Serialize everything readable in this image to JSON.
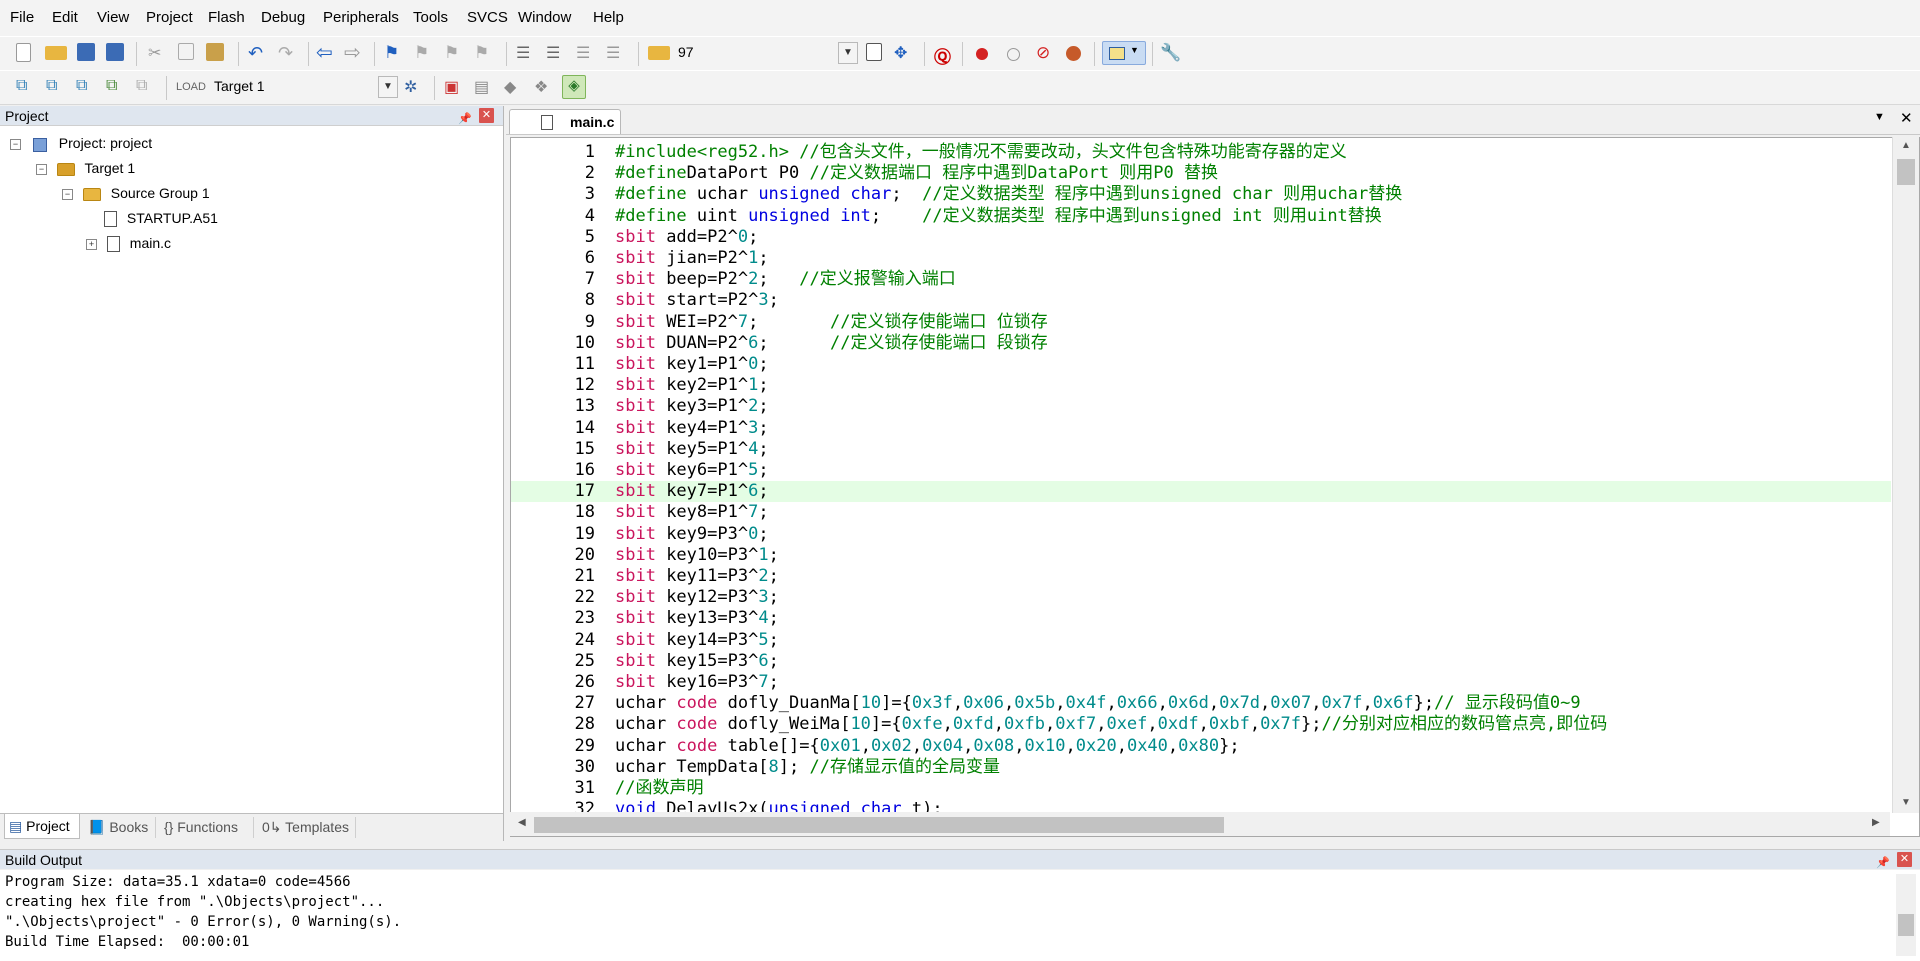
{
  "menu": [
    "File",
    "Edit",
    "View",
    "Project",
    "Flash",
    "Debug",
    "Peripherals",
    "Tools",
    "SVCS",
    "Window",
    "Help"
  ],
  "toolbar": {
    "find_value": "97",
    "target_value": "Target 1"
  },
  "project_panel": {
    "title": "Project",
    "tree": {
      "project": "Project: project",
      "target": "Target 1",
      "group": "Source Group 1",
      "files": [
        "STARTUP.A51",
        "main.c"
      ]
    },
    "tabs": [
      "Project",
      "Books",
      "Functions",
      "Templates"
    ]
  },
  "editor": {
    "tab_label": "main.c",
    "current_line": 17,
    "lines": [
      {
        "n": "1",
        "t": [
          [
            "pp",
            "#include<reg52.h> "
          ],
          [
            "cm",
            "//包含头文件，一般情况不需要改动，头文件包含特殊功能寄存器的定义"
          ]
        ]
      },
      {
        "n": "2",
        "t": [
          [
            "pp",
            "#define"
          ],
          [
            "",
            "DataPort P0 "
          ],
          [
            "cm",
            "//定义数据端口 程序中遇到DataPort 则用P0 替换"
          ]
        ]
      },
      {
        "n": "3",
        "t": [
          [
            "pp",
            "#define"
          ],
          [
            "",
            " uchar "
          ],
          [
            "ty",
            "unsigned char"
          ],
          [
            "",
            ";  "
          ],
          [
            "cm",
            "//定义数据类型 程序中遇到unsigned char 则用uchar替换"
          ]
        ]
      },
      {
        "n": "4",
        "t": [
          [
            "pp",
            "#define"
          ],
          [
            "",
            " uint "
          ],
          [
            "ty",
            "unsigned int"
          ],
          [
            "",
            ";    "
          ],
          [
            "cm",
            "//定义数据类型 程序中遇到unsigned int 则用uint替换"
          ]
        ]
      },
      {
        "n": "5",
        "t": [
          [
            "kw",
            "sbit"
          ],
          [
            "",
            " add=P2^"
          ],
          [
            "num",
            "0"
          ],
          [
            "",
            ";"
          ]
        ]
      },
      {
        "n": "6",
        "t": [
          [
            "kw",
            "sbit"
          ],
          [
            "",
            " jian=P2^"
          ],
          [
            "num",
            "1"
          ],
          [
            "",
            ";"
          ]
        ]
      },
      {
        "n": "7",
        "t": [
          [
            "kw",
            "sbit"
          ],
          [
            "",
            " beep=P2^"
          ],
          [
            "num",
            "2"
          ],
          [
            "",
            ";   "
          ],
          [
            "cm",
            "//定义报警输入端口"
          ]
        ]
      },
      {
        "n": "8",
        "t": [
          [
            "kw",
            "sbit"
          ],
          [
            "",
            " start=P2^"
          ],
          [
            "num",
            "3"
          ],
          [
            "",
            ";"
          ]
        ]
      },
      {
        "n": "9",
        "t": [
          [
            "kw",
            "sbit"
          ],
          [
            "",
            " WEI=P2^"
          ],
          [
            "num",
            "7"
          ],
          [
            "",
            ";       "
          ],
          [
            "cm",
            "//定义锁存使能端口 位锁存"
          ]
        ]
      },
      {
        "n": "10",
        "t": [
          [
            "kw",
            "sbit"
          ],
          [
            "",
            " DUAN=P2^"
          ],
          [
            "num",
            "6"
          ],
          [
            "",
            ";      "
          ],
          [
            "cm",
            "//定义锁存使能端口 段锁存"
          ]
        ]
      },
      {
        "n": "11",
        "t": [
          [
            "kw",
            "sbit"
          ],
          [
            "",
            " key1=P1^"
          ],
          [
            "num",
            "0"
          ],
          [
            "",
            ";"
          ]
        ]
      },
      {
        "n": "12",
        "t": [
          [
            "kw",
            "sbit"
          ],
          [
            "",
            " key2=P1^"
          ],
          [
            "num",
            "1"
          ],
          [
            "",
            ";"
          ]
        ]
      },
      {
        "n": "13",
        "t": [
          [
            "kw",
            "sbit"
          ],
          [
            "",
            " key3=P1^"
          ],
          [
            "num",
            "2"
          ],
          [
            "",
            ";"
          ]
        ]
      },
      {
        "n": "14",
        "t": [
          [
            "kw",
            "sbit"
          ],
          [
            "",
            " key4=P1^"
          ],
          [
            "num",
            "3"
          ],
          [
            "",
            ";"
          ]
        ]
      },
      {
        "n": "15",
        "t": [
          [
            "kw",
            "sbit"
          ],
          [
            "",
            " key5=P1^"
          ],
          [
            "num",
            "4"
          ],
          [
            "",
            ";"
          ]
        ]
      },
      {
        "n": "16",
        "t": [
          [
            "kw",
            "sbit"
          ],
          [
            "",
            " key6=P1^"
          ],
          [
            "num",
            "5"
          ],
          [
            "",
            ";"
          ]
        ]
      },
      {
        "n": "17",
        "t": [
          [
            "kw",
            "sbit"
          ],
          [
            "",
            " key7=P1^"
          ],
          [
            "num",
            "6"
          ],
          [
            "",
            ";"
          ]
        ]
      },
      {
        "n": "18",
        "t": [
          [
            "kw",
            "sbit"
          ],
          [
            "",
            " key8=P1^"
          ],
          [
            "num",
            "7"
          ],
          [
            "",
            ";"
          ]
        ]
      },
      {
        "n": "19",
        "t": [
          [
            "kw",
            "sbit"
          ],
          [
            "",
            " key9=P3^"
          ],
          [
            "num",
            "0"
          ],
          [
            "",
            ";"
          ]
        ]
      },
      {
        "n": "20",
        "t": [
          [
            "kw",
            "sbit"
          ],
          [
            "",
            " key10=P3^"
          ],
          [
            "num",
            "1"
          ],
          [
            "",
            ";"
          ]
        ]
      },
      {
        "n": "21",
        "t": [
          [
            "kw",
            "sbit"
          ],
          [
            "",
            " key11=P3^"
          ],
          [
            "num",
            "2"
          ],
          [
            "",
            ";"
          ]
        ]
      },
      {
        "n": "22",
        "t": [
          [
            "kw",
            "sbit"
          ],
          [
            "",
            " key12=P3^"
          ],
          [
            "num",
            "3"
          ],
          [
            "",
            ";"
          ]
        ]
      },
      {
        "n": "23",
        "t": [
          [
            "kw",
            "sbit"
          ],
          [
            "",
            " key13=P3^"
          ],
          [
            "num",
            "4"
          ],
          [
            "",
            ";"
          ]
        ]
      },
      {
        "n": "24",
        "t": [
          [
            "kw",
            "sbit"
          ],
          [
            "",
            " key14=P3^"
          ],
          [
            "num",
            "5"
          ],
          [
            "",
            ";"
          ]
        ]
      },
      {
        "n": "25",
        "t": [
          [
            "kw",
            "sbit"
          ],
          [
            "",
            " key15=P3^"
          ],
          [
            "num",
            "6"
          ],
          [
            "",
            ";"
          ]
        ]
      },
      {
        "n": "26",
        "t": [
          [
            "kw",
            "sbit"
          ],
          [
            "",
            " key16=P3^"
          ],
          [
            "num",
            "7"
          ],
          [
            "",
            ";"
          ]
        ]
      },
      {
        "n": "27",
        "t": [
          [
            "",
            "uchar "
          ],
          [
            "kw",
            "code"
          ],
          [
            "",
            " dofly_DuanMa["
          ],
          [
            "num",
            "10"
          ],
          [
            "",
            "]={"
          ],
          [
            "num",
            "0x3f"
          ],
          [
            "",
            ","
          ],
          [
            "num",
            "0x06"
          ],
          [
            "",
            ","
          ],
          [
            "num",
            "0x5b"
          ],
          [
            "",
            ","
          ],
          [
            "num",
            "0x4f"
          ],
          [
            "",
            ","
          ],
          [
            "num",
            "0x66"
          ],
          [
            "",
            ","
          ],
          [
            "num",
            "0x6d"
          ],
          [
            "",
            ","
          ],
          [
            "num",
            "0x7d"
          ],
          [
            "",
            ","
          ],
          [
            "num",
            "0x07"
          ],
          [
            "",
            ","
          ],
          [
            "num",
            "0x7f"
          ],
          [
            "",
            ","
          ],
          [
            "num",
            "0x6f"
          ],
          [
            "",
            "};"
          ],
          [
            "cm",
            "// 显示段码值0~9"
          ]
        ]
      },
      {
        "n": "28",
        "t": [
          [
            "",
            "uchar "
          ],
          [
            "kw",
            "code"
          ],
          [
            "",
            " dofly_WeiMa["
          ],
          [
            "num",
            "10"
          ],
          [
            "",
            "]={"
          ],
          [
            "num",
            "0xfe"
          ],
          [
            "",
            ","
          ],
          [
            "num",
            "0xfd"
          ],
          [
            "",
            ","
          ],
          [
            "num",
            "0xfb"
          ],
          [
            "",
            ","
          ],
          [
            "num",
            "0xf7"
          ],
          [
            "",
            ","
          ],
          [
            "num",
            "0xef"
          ],
          [
            "",
            ","
          ],
          [
            "num",
            "0xdf"
          ],
          [
            "",
            ","
          ],
          [
            "num",
            "0xbf"
          ],
          [
            "",
            ","
          ],
          [
            "num",
            "0x7f"
          ],
          [
            "",
            "};"
          ],
          [
            "cm",
            "//分别对应相应的数码管点亮,即位码"
          ]
        ]
      },
      {
        "n": "29",
        "t": [
          [
            "",
            "uchar "
          ],
          [
            "kw",
            "code"
          ],
          [
            "",
            " table[]={"
          ],
          [
            "num",
            "0x01"
          ],
          [
            "",
            ","
          ],
          [
            "num",
            "0x02"
          ],
          [
            "",
            ","
          ],
          [
            "num",
            "0x04"
          ],
          [
            "",
            ","
          ],
          [
            "num",
            "0x08"
          ],
          [
            "",
            ","
          ],
          [
            "num",
            "0x10"
          ],
          [
            "",
            ","
          ],
          [
            "num",
            "0x20"
          ],
          [
            "",
            ","
          ],
          [
            "num",
            "0x40"
          ],
          [
            "",
            ","
          ],
          [
            "num",
            "0x80"
          ],
          [
            "",
            "};"
          ]
        ]
      },
      {
        "n": "30",
        "t": [
          [
            "",
            "uchar TempData["
          ],
          [
            "num",
            "8"
          ],
          [
            "",
            "]; "
          ],
          [
            "cm",
            "//存储显示值的全局变量"
          ]
        ]
      },
      {
        "n": "31",
        "t": [
          [
            "cm",
            "//函数声明"
          ]
        ]
      },
      {
        "n": "32",
        "t": [
          [
            "ty",
            "void"
          ],
          [
            "",
            " DelayUs2x("
          ],
          [
            "ty",
            "unsigned char"
          ],
          [
            "",
            " t);"
          ]
        ]
      }
    ]
  },
  "build_output": {
    "title": "Build Output",
    "lines": [
      "Program Size: data=35.1 xdata=0 code=4566",
      "creating hex file from \".\\Objects\\project\"...",
      "\".\\Objects\\project\" - 0 Error(s), 0 Warning(s).",
      "Build Time Elapsed:  00:00:01"
    ]
  }
}
